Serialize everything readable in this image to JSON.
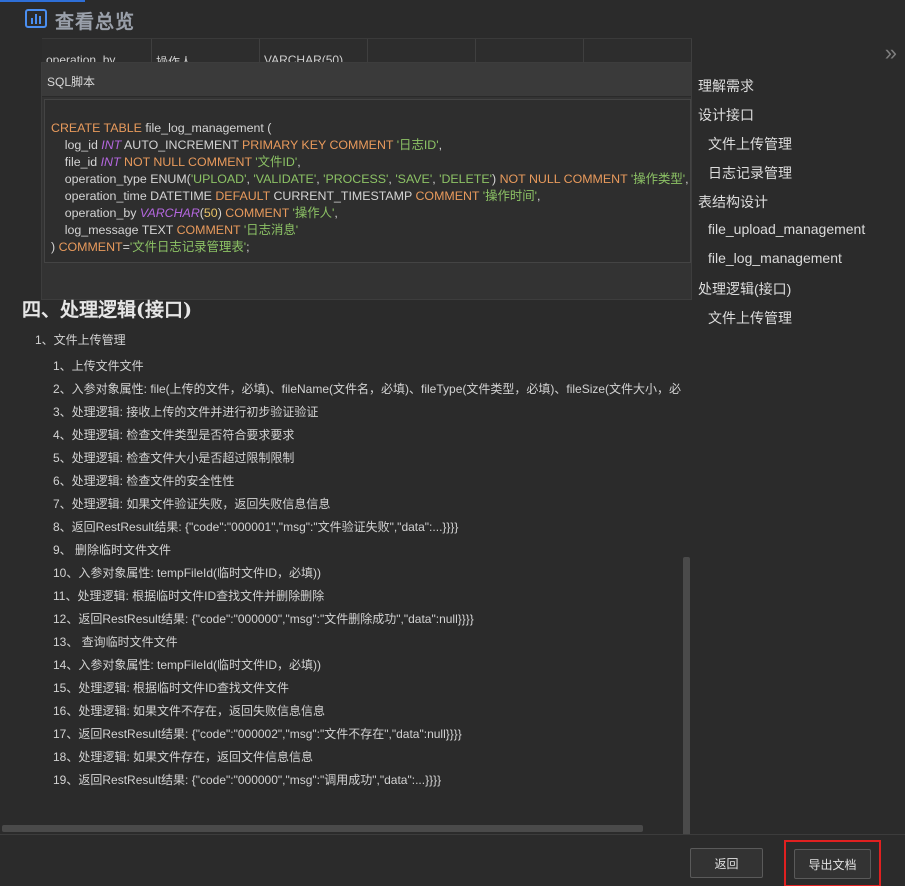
{
  "header": {
    "title": "查看总览"
  },
  "table_row": [
    "operation_by",
    "操作人",
    "VARCHAR(50)",
    "",
    "",
    ""
  ],
  "sql_panel": {
    "title": "SQL脚本",
    "lines": [
      [
        {
          "t": "CREATE TABLE ",
          "c": "kw"
        },
        {
          "t": "file_log_management (",
          "c": ""
        }
      ],
      [
        {
          "t": "    log_id ",
          "c": ""
        },
        {
          "t": "INT",
          "c": "ty"
        },
        {
          "t": " AUTO_INCREMENT ",
          "c": ""
        },
        {
          "t": "PRIMARY KEY COMMENT ",
          "c": "kw"
        },
        {
          "t": "'日志ID'",
          "c": "str"
        },
        {
          "t": ",",
          "c": ""
        }
      ],
      [
        {
          "t": "    file_id ",
          "c": ""
        },
        {
          "t": "INT",
          "c": "ty"
        },
        {
          "t": " NOT NULL COMMENT ",
          "c": "kw"
        },
        {
          "t": "'文件ID'",
          "c": "str"
        },
        {
          "t": ",",
          "c": ""
        }
      ],
      [
        {
          "t": "    operation_type ENUM(",
          "c": ""
        },
        {
          "t": "'UPLOAD'",
          "c": "str"
        },
        {
          "t": ", ",
          "c": ""
        },
        {
          "t": "'VALIDATE'",
          "c": "str"
        },
        {
          "t": ", ",
          "c": ""
        },
        {
          "t": "'PROCESS'",
          "c": "str"
        },
        {
          "t": ", ",
          "c": ""
        },
        {
          "t": "'SAVE'",
          "c": "str"
        },
        {
          "t": ", ",
          "c": ""
        },
        {
          "t": "'DELETE'",
          "c": "str"
        },
        {
          "t": ") ",
          "c": ""
        },
        {
          "t": "NOT NULL COMMENT ",
          "c": "kw"
        },
        {
          "t": "'操作类型'",
          "c": "str"
        },
        {
          "t": ",",
          "c": ""
        }
      ],
      [
        {
          "t": "    operation_time DATETIME ",
          "c": ""
        },
        {
          "t": "DEFAULT ",
          "c": "kw"
        },
        {
          "t": "CURRENT_TIMESTAMP ",
          "c": ""
        },
        {
          "t": "COMMENT ",
          "c": "kw"
        },
        {
          "t": "'操作时间'",
          "c": "str"
        },
        {
          "t": ",",
          "c": ""
        }
      ],
      [
        {
          "t": "    operation_by ",
          "c": ""
        },
        {
          "t": "VARCHAR",
          "c": "ty"
        },
        {
          "t": "(",
          "c": ""
        },
        {
          "t": "50",
          "c": "num"
        },
        {
          "t": ") ",
          "c": ""
        },
        {
          "t": "COMMENT ",
          "c": "kw"
        },
        {
          "t": "'操作人'",
          "c": "str"
        },
        {
          "t": ",",
          "c": ""
        }
      ],
      [
        {
          "t": "    log_message TEXT ",
          "c": ""
        },
        {
          "t": "COMMENT ",
          "c": "kw"
        },
        {
          "t": "'日志消息'",
          "c": "str"
        }
      ],
      [
        {
          "t": ") ",
          "c": ""
        },
        {
          "t": "COMMENT",
          "c": "kw"
        },
        {
          "t": "=",
          "c": ""
        },
        {
          "t": "'文件日志记录管理表'",
          "c": "str"
        },
        {
          "t": ";",
          "c": ""
        }
      ]
    ]
  },
  "section": {
    "title": "四、处理逻辑(接口)",
    "subtitle": "1、文件上传管理",
    "steps": [
      "1、上传文件文件",
      "2、入参对象属性: file(上传的文件，必填)、fileName(文件名，必填)、fileType(文件类型，必填)、fileSize(文件大小，必",
      "3、处理逻辑: 接收上传的文件并进行初步验证验证",
      "4、处理逻辑: 检查文件类型是否符合要求要求",
      "5、处理逻辑: 检查文件大小是否超过限制限制",
      "6、处理逻辑: 检查文件的安全性性",
      "7、处理逻辑: 如果文件验证失败，返回失败信息信息",
      "8、返回RestResult结果: {\"code\":\"000001\",\"msg\":\"文件验证失败\",\"data\":...}}}}",
      "9、  删除临时文件文件",
      "10、入参对象属性: tempFileId(临时文件ID，必填))",
      "11、处理逻辑: 根据临时文件ID查找文件并删除删除",
      "12、返回RestResult结果: {\"code\":\"000000\",\"msg\":\"文件删除成功\",\"data\":null}}}}",
      "13、  查询临时文件文件",
      "14、入参对象属性: tempFileId(临时文件ID，必填))",
      "15、处理逻辑: 根据临时文件ID查找文件文件",
      "16、处理逻辑: 如果文件不存在，返回失败信息信息",
      "17、返回RestResult结果: {\"code\":\"000002\",\"msg\":\"文件不存在\",\"data\":null}}}}",
      "18、处理逻辑: 如果文件存在，返回文件信息信息",
      "19、返回RestResult结果: {\"code\":\"000000\",\"msg\":\"调用成功\",\"data\":...}}}}"
    ]
  },
  "outline": {
    "toggle": "»",
    "items": [
      {
        "label": "理解需求",
        "level": 1
      },
      {
        "label": "设计接口",
        "level": 1
      },
      {
        "label": "文件上传管理",
        "level": 2
      },
      {
        "label": "日志记录管理",
        "level": 2
      },
      {
        "label": "表结构设计",
        "level": 1
      },
      {
        "label": "file_upload_management",
        "level": 2
      },
      {
        "label": "file_log_management",
        "level": 2
      },
      {
        "label": "处理逻辑(接口)",
        "level": 1
      },
      {
        "label": "文件上传管理",
        "level": 2
      }
    ]
  },
  "footer": {
    "back_label": "返回",
    "export_label": "导出文档"
  },
  "colors": {
    "accent": "#2e6fd8",
    "highlight_border": "#e02020",
    "keyword": "#e89a5c",
    "string": "#8cc265",
    "type": "#b567e0"
  }
}
